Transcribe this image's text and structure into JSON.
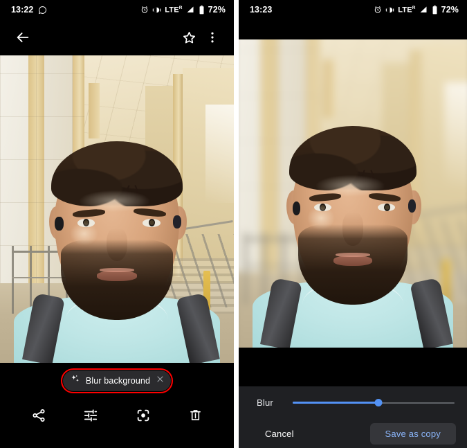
{
  "left_screen": {
    "status_bar": {
      "time": "13:22",
      "app_icon": "whatsapp-icon",
      "alarm_icon": "alarm-icon",
      "vibrate_icon": "vibrate-icon",
      "network_label": "LTE",
      "network_sup": "R",
      "signal_icon": "signal-bars-icon",
      "battery_icon": "battery-icon",
      "battery_pct": "72%"
    },
    "app_bar": {
      "back_label": "Back",
      "back_icon": "arrow-back-icon",
      "star_label": "Favorite",
      "star_icon": "star-outline-icon",
      "more_label": "More options",
      "more_icon": "overflow-menu-icon"
    },
    "photo": {
      "alt": "Selfie of bearded man in light blue t-shirt with backpack in a tiled corridor",
      "blurred": false
    },
    "chip": {
      "label": "Blur background",
      "sparkle_icon": "sparkle-icon",
      "close_icon": "close-icon",
      "outline_color": "#ff0000",
      "chip_bg": "#2b2b2e"
    },
    "bottom_toolbar": [
      {
        "name": "share",
        "label": "Share",
        "icon": "share-icon"
      },
      {
        "name": "edit",
        "label": "Edit",
        "icon": "tune-sliders-icon"
      },
      {
        "name": "lens",
        "label": "Lens",
        "icon": "google-lens-icon"
      },
      {
        "name": "delete",
        "label": "Delete",
        "icon": "trash-icon"
      }
    ]
  },
  "right_screen": {
    "status_bar": {
      "time": "13:23",
      "alarm_icon": "alarm-icon",
      "vibrate_icon": "vibrate-icon",
      "network_label": "LTE",
      "network_sup": "R",
      "signal_icon": "signal-bars-icon",
      "battery_icon": "battery-icon",
      "battery_pct": "72%"
    },
    "photo": {
      "alt": "Same selfie with the background blurred by the portrait blur effect",
      "blurred": true
    },
    "editor": {
      "slider": {
        "label": "Blur",
        "value": 53,
        "min": 0,
        "max": 100,
        "fill_color": "#5392f5",
        "track_color": "#5f6368"
      },
      "cancel_label": "Cancel",
      "save_label": "Save as copy",
      "save_text_color": "#8ab4f8",
      "save_bg_color": "#35363a",
      "panel_bg": "#1f2023"
    }
  }
}
